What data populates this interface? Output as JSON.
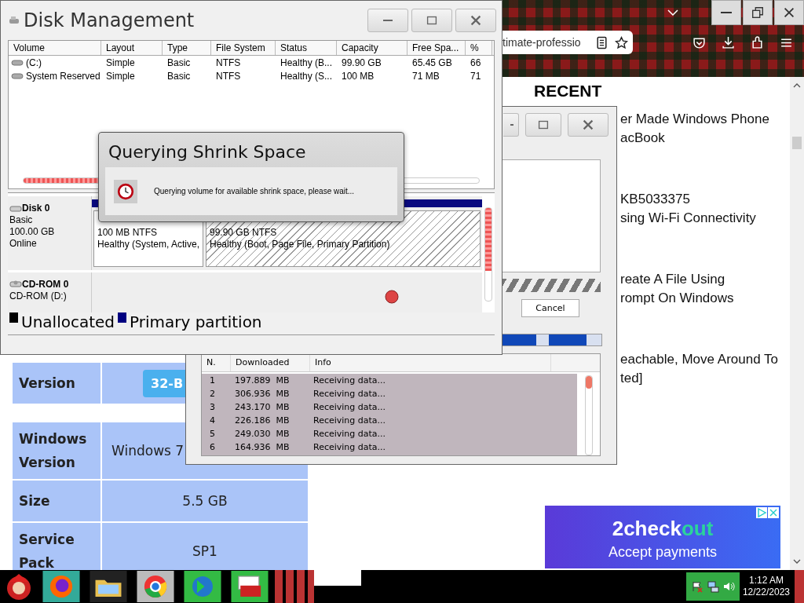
{
  "browser": {
    "address": "timate-professio",
    "recent_heading": "RECENT",
    "articles": [
      {
        "lines": [
          "er Made Windows Phone",
          "acBook"
        ]
      },
      {
        "lines": [
          "KB5033375",
          "sing Wi-Fi Connectivity"
        ]
      },
      {
        "lines": [
          "reate A File Using",
          "rompt On Windows"
        ]
      },
      {
        "lines": [
          "eachable, Move Around To",
          "ted]"
        ]
      }
    ],
    "spec_table": [
      {
        "label": "Version",
        "value": "32-B",
        "kind": "button"
      },
      {
        "label": "Windows Version",
        "value": "Windows 7",
        "kind": "clipped_text"
      },
      {
        "label": "Size",
        "value": "5.5 GB",
        "kind": "text"
      },
      {
        "label": "Service Pack",
        "value": "SP1",
        "kind": "text"
      }
    ],
    "ad": {
      "logo_main": "2check",
      "logo_accent": "out",
      "tagline": "Accept payments"
    }
  },
  "download_window": {
    "cancel": "Cancel",
    "marquee": {
      "level": 1
    },
    "progress": {
      "level": 0.85
    },
    "columns": [
      "N.",
      "Downloaded",
      "Info"
    ],
    "rows": [
      {
        "n": "1",
        "downloaded": "197.889  MB",
        "info": "Receiving data..."
      },
      {
        "n": "2",
        "downloaded": "306.936  MB",
        "info": "Receiving data..."
      },
      {
        "n": "3",
        "downloaded": "243.170  MB",
        "info": "Receiving data..."
      },
      {
        "n": "4",
        "downloaded": "226.186  MB",
        "info": "Receiving data..."
      },
      {
        "n": "5",
        "downloaded": "249.030  MB",
        "info": "Receiving data..."
      },
      {
        "n": "6",
        "downloaded": "164.936  MB",
        "info": "Receiving data..."
      }
    ]
  },
  "disk_management": {
    "title": "Disk Management",
    "columns": [
      "Volume",
      "Layout",
      "Type",
      "File System",
      "Status",
      "Capacity",
      "Free Spa...",
      "%"
    ],
    "volumes": [
      [
        "(C:)",
        "Simple",
        "Basic",
        "NTFS",
        "Healthy (B...",
        "99.90 GB",
        "65.45 GB",
        "66"
      ],
      [
        "System Reserved",
        "Simple",
        "Basic",
        "NTFS",
        "Healthy (S...",
        "100 MB",
        "71 MB",
        "71"
      ]
    ],
    "disks": [
      {
        "name": "Disk 0",
        "kind": "disk",
        "lines": [
          "Basic",
          "100.00 GB",
          "Online"
        ],
        "partitions": [
          {
            "kind": "plain",
            "lines": [
              "100 MB NTFS",
              "Healthy (System, Active,"
            ]
          },
          {
            "kind": "hatched",
            "lines": [
              "99.90 GB NTFS",
              "Healthy (Boot, Page File, Primary Partition)"
            ]
          }
        ]
      },
      {
        "name": "CD-ROM 0",
        "kind": "cdrom",
        "lines": [
          "CD-ROM (D:)"
        ]
      }
    ],
    "legend": [
      {
        "label": "Unallocated",
        "color": "#000000"
      },
      {
        "label": "Primary partition",
        "color": "#000080"
      }
    ]
  },
  "dialog": {
    "title": "Querying Shrink Space",
    "message": "Querying volume for available shrink space, please wait..."
  },
  "taskbar": {
    "time": "1:12 AM",
    "date": "12/22/2023"
  }
}
